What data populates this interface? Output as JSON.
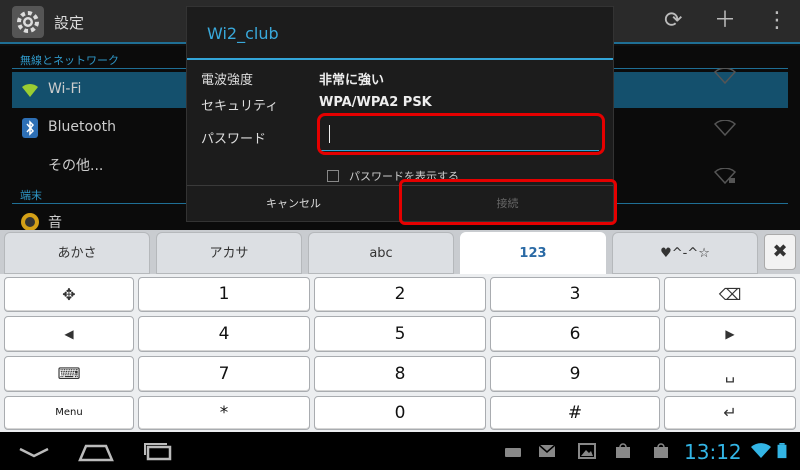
{
  "app": {
    "title": "設定"
  },
  "settings": {
    "section_wireless": "無線とネットワーク",
    "section_device": "端末",
    "items": [
      {
        "label": "Wi-Fi"
      },
      {
        "label": "Bluetooth"
      },
      {
        "label": "その他..."
      },
      {
        "label": "音"
      }
    ]
  },
  "dialog": {
    "title": "Wi2_club",
    "signal_label": "電波強度",
    "signal_value": "非常に強い",
    "security_label": "セキュリティ",
    "security_value": "WPA/WPA2 PSK",
    "password_label": "パスワード",
    "password_value": "",
    "show_password_label": "パスワードを表示する",
    "cancel_label": "キャンセル",
    "connect_label": "接続"
  },
  "keyboard": {
    "tabs": [
      {
        "label": "あかさ"
      },
      {
        "label": "アカサ"
      },
      {
        "label": "abc"
      },
      {
        "label": "123"
      },
      {
        "label": "♥^-^☆"
      }
    ],
    "close_label": "✖",
    "keys": {
      "move": "✥",
      "k1": "1",
      "k2": "2",
      "k3": "3",
      "backspace": "⌫",
      "left": "◀",
      "k4": "4",
      "k5": "5",
      "k6": "6",
      "right": "▶",
      "keyboard_icon": "⌨",
      "k7": "7",
      "k8": "8",
      "k9": "9",
      "space": "␣",
      "menu": "Menu",
      "star": "*",
      "k0": "0",
      "hash": "#",
      "enter": "↵"
    }
  },
  "status": {
    "time": "13:12"
  },
  "colors": {
    "accent": "#33b5e5",
    "highlight": "#e50000"
  }
}
